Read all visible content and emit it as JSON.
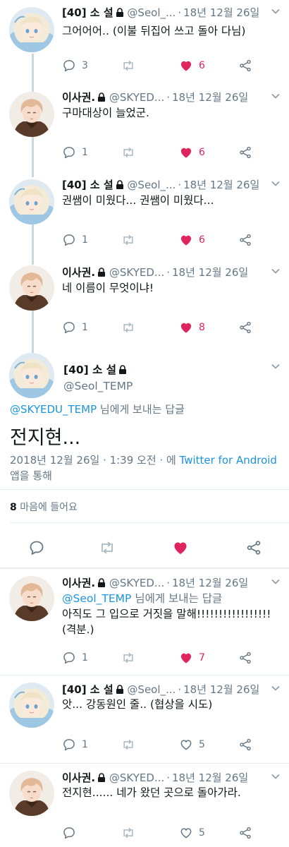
{
  "colors": {
    "link": "#1b95e0",
    "like": "#e0245e",
    "muted": "#657786",
    "line": "#ccd6dd"
  },
  "icons": {
    "lock": "lock-icon",
    "reply": "reply-icon",
    "retweet": "retweet-icon",
    "like": "heart-icon",
    "share": "share-icon",
    "caret": "chevron-down-icon"
  },
  "tweets": [
    {
      "name": "[40] 소 설",
      "handle": "@Seol_...",
      "time": "18년 12월 26일",
      "text": "그어어어.. (이불 뒤집어 쓰고 돌아 다님)",
      "replies": "3",
      "retweets": "",
      "likes": "6",
      "liked": true
    },
    {
      "name": "이사권.",
      "handle": "@SKYED...",
      "time": "18년 12월 26일",
      "text": "구마대상이 늘었군.",
      "replies": "1",
      "retweets": "",
      "likes": "6",
      "liked": true
    },
    {
      "name": "[40] 소 설",
      "handle": "@Seol_...",
      "time": "18년 12월 26일",
      "text": "권쌤이 미웠다... 권쌤이 미웠다...",
      "replies": "1",
      "retweets": "",
      "likes": "6",
      "liked": true
    },
    {
      "name": "이사권.",
      "handle": "@SKYED...",
      "time": "18년 12월 26일",
      "text": "네 이름이 무엇이냐!",
      "replies": "1",
      "retweets": "",
      "likes": "8",
      "liked": true
    }
  ],
  "main_tweet": {
    "name": "[40] 소 설",
    "handle": "@Seol_TEMP",
    "reply_to_user": "@SKYEDU_TEMP",
    "reply_to_suffix": " 님에게 보내는 답글",
    "text": "전지현...",
    "timestamp": "2018년 12월 26일 · 1:39 오전 · 에 ",
    "client": "Twitter for Android",
    "client_suffix": " 앱을 통해",
    "likes_count": "8",
    "likes_label": " 마음에 들어요"
  },
  "replies": [
    {
      "name": "이사권.",
      "handle": "@SKYED...",
      "time": "18년 12월 26일",
      "reply_to_user": "@Seol_TEMP",
      "reply_to_suffix": " 님에게 보내는 답글",
      "text": "아직도 그 입으로 거짓을 말해!!!!!!!!!!!!!!!!! (격분.)",
      "replies": "1",
      "retweets": "",
      "likes": "7",
      "liked": true
    },
    {
      "name": "[40] 소 설",
      "handle": "@Seol_...",
      "time": "18년 12월 26일",
      "text": "앗... 강동원인 줄.. (협상을 시도)",
      "replies": "1",
      "retweets": "",
      "likes": "5",
      "liked": false
    },
    {
      "name": "이사권.",
      "handle": "@SKYED...",
      "time": "18년 12월 26일",
      "text": "전지현...... 네가 왔던 곳으로 돌아가라.",
      "replies": "",
      "retweets": "",
      "likes": "5",
      "liked": false
    }
  ]
}
